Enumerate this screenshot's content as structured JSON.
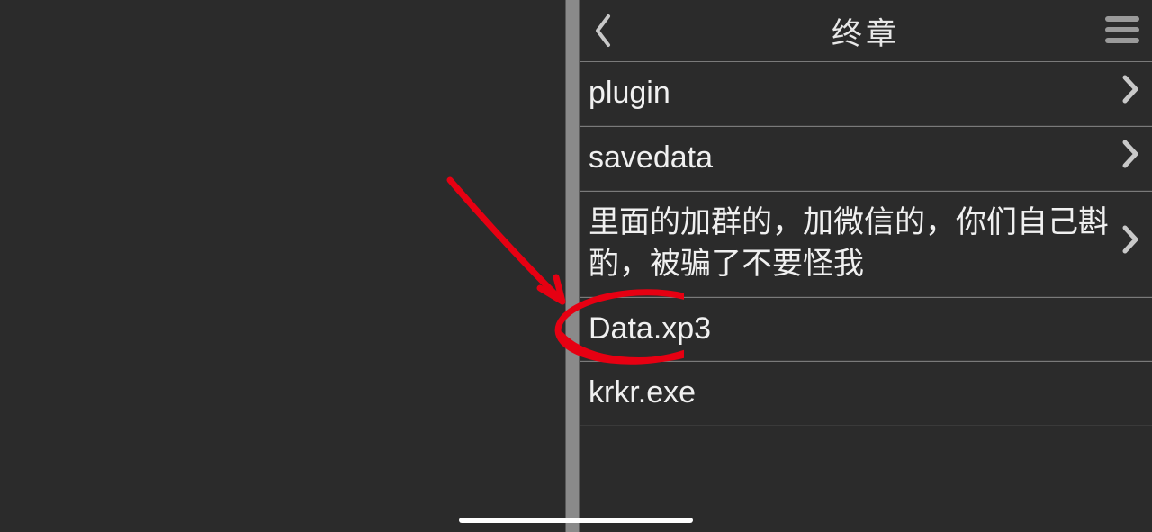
{
  "header": {
    "title": "终章"
  },
  "items": [
    {
      "label": "plugin",
      "hasChevron": true
    },
    {
      "label": "savedata",
      "hasChevron": true
    },
    {
      "label": "里面的加群的，加微信的，你们自己斟酌，被骗了不要怪我",
      "hasChevron": true
    },
    {
      "label": "Data.xp3",
      "hasChevron": false
    },
    {
      "label": "krkr.exe",
      "hasChevron": false
    }
  ],
  "annotation": {
    "color": "#e60012"
  }
}
